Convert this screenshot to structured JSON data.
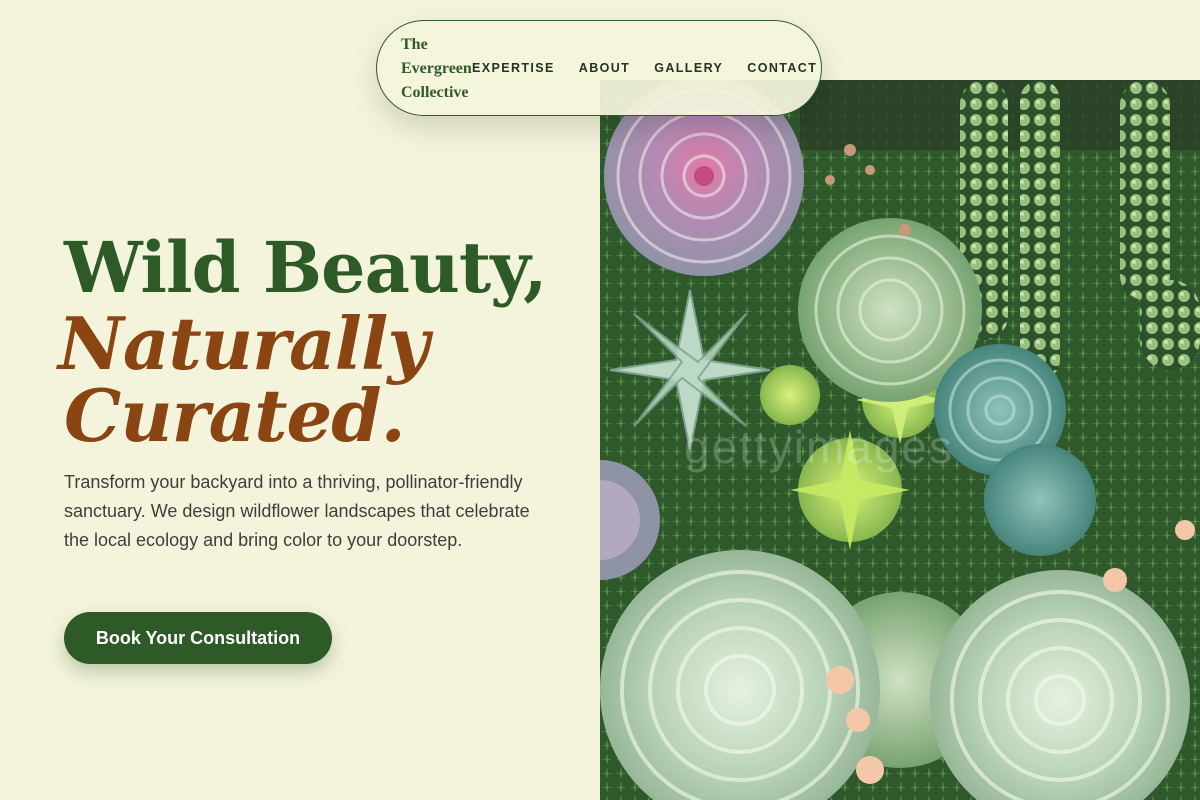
{
  "nav": {
    "brand": "The Evergreen Collective",
    "links": [
      {
        "label": "EXPERTISE"
      },
      {
        "label": "ABOUT"
      },
      {
        "label": "GALLERY"
      },
      {
        "label": "CONTACT"
      }
    ]
  },
  "hero": {
    "title_line1": "Wild Beauty,",
    "title_line2": "Naturally",
    "title_line3": "Curated.",
    "description": "Transform your backyard into a thriving, pollinator-friendly sanctuary. We design wildflower landscapes that celebrate the local ecology and bring color to your doorstep.",
    "cta_label": "Book Your Consultation"
  },
  "image": {
    "watermark": "gettyimages"
  },
  "colors": {
    "background": "#f4f4dc",
    "primary_green": "#2d5a27",
    "accent_brown": "#8b4513"
  }
}
